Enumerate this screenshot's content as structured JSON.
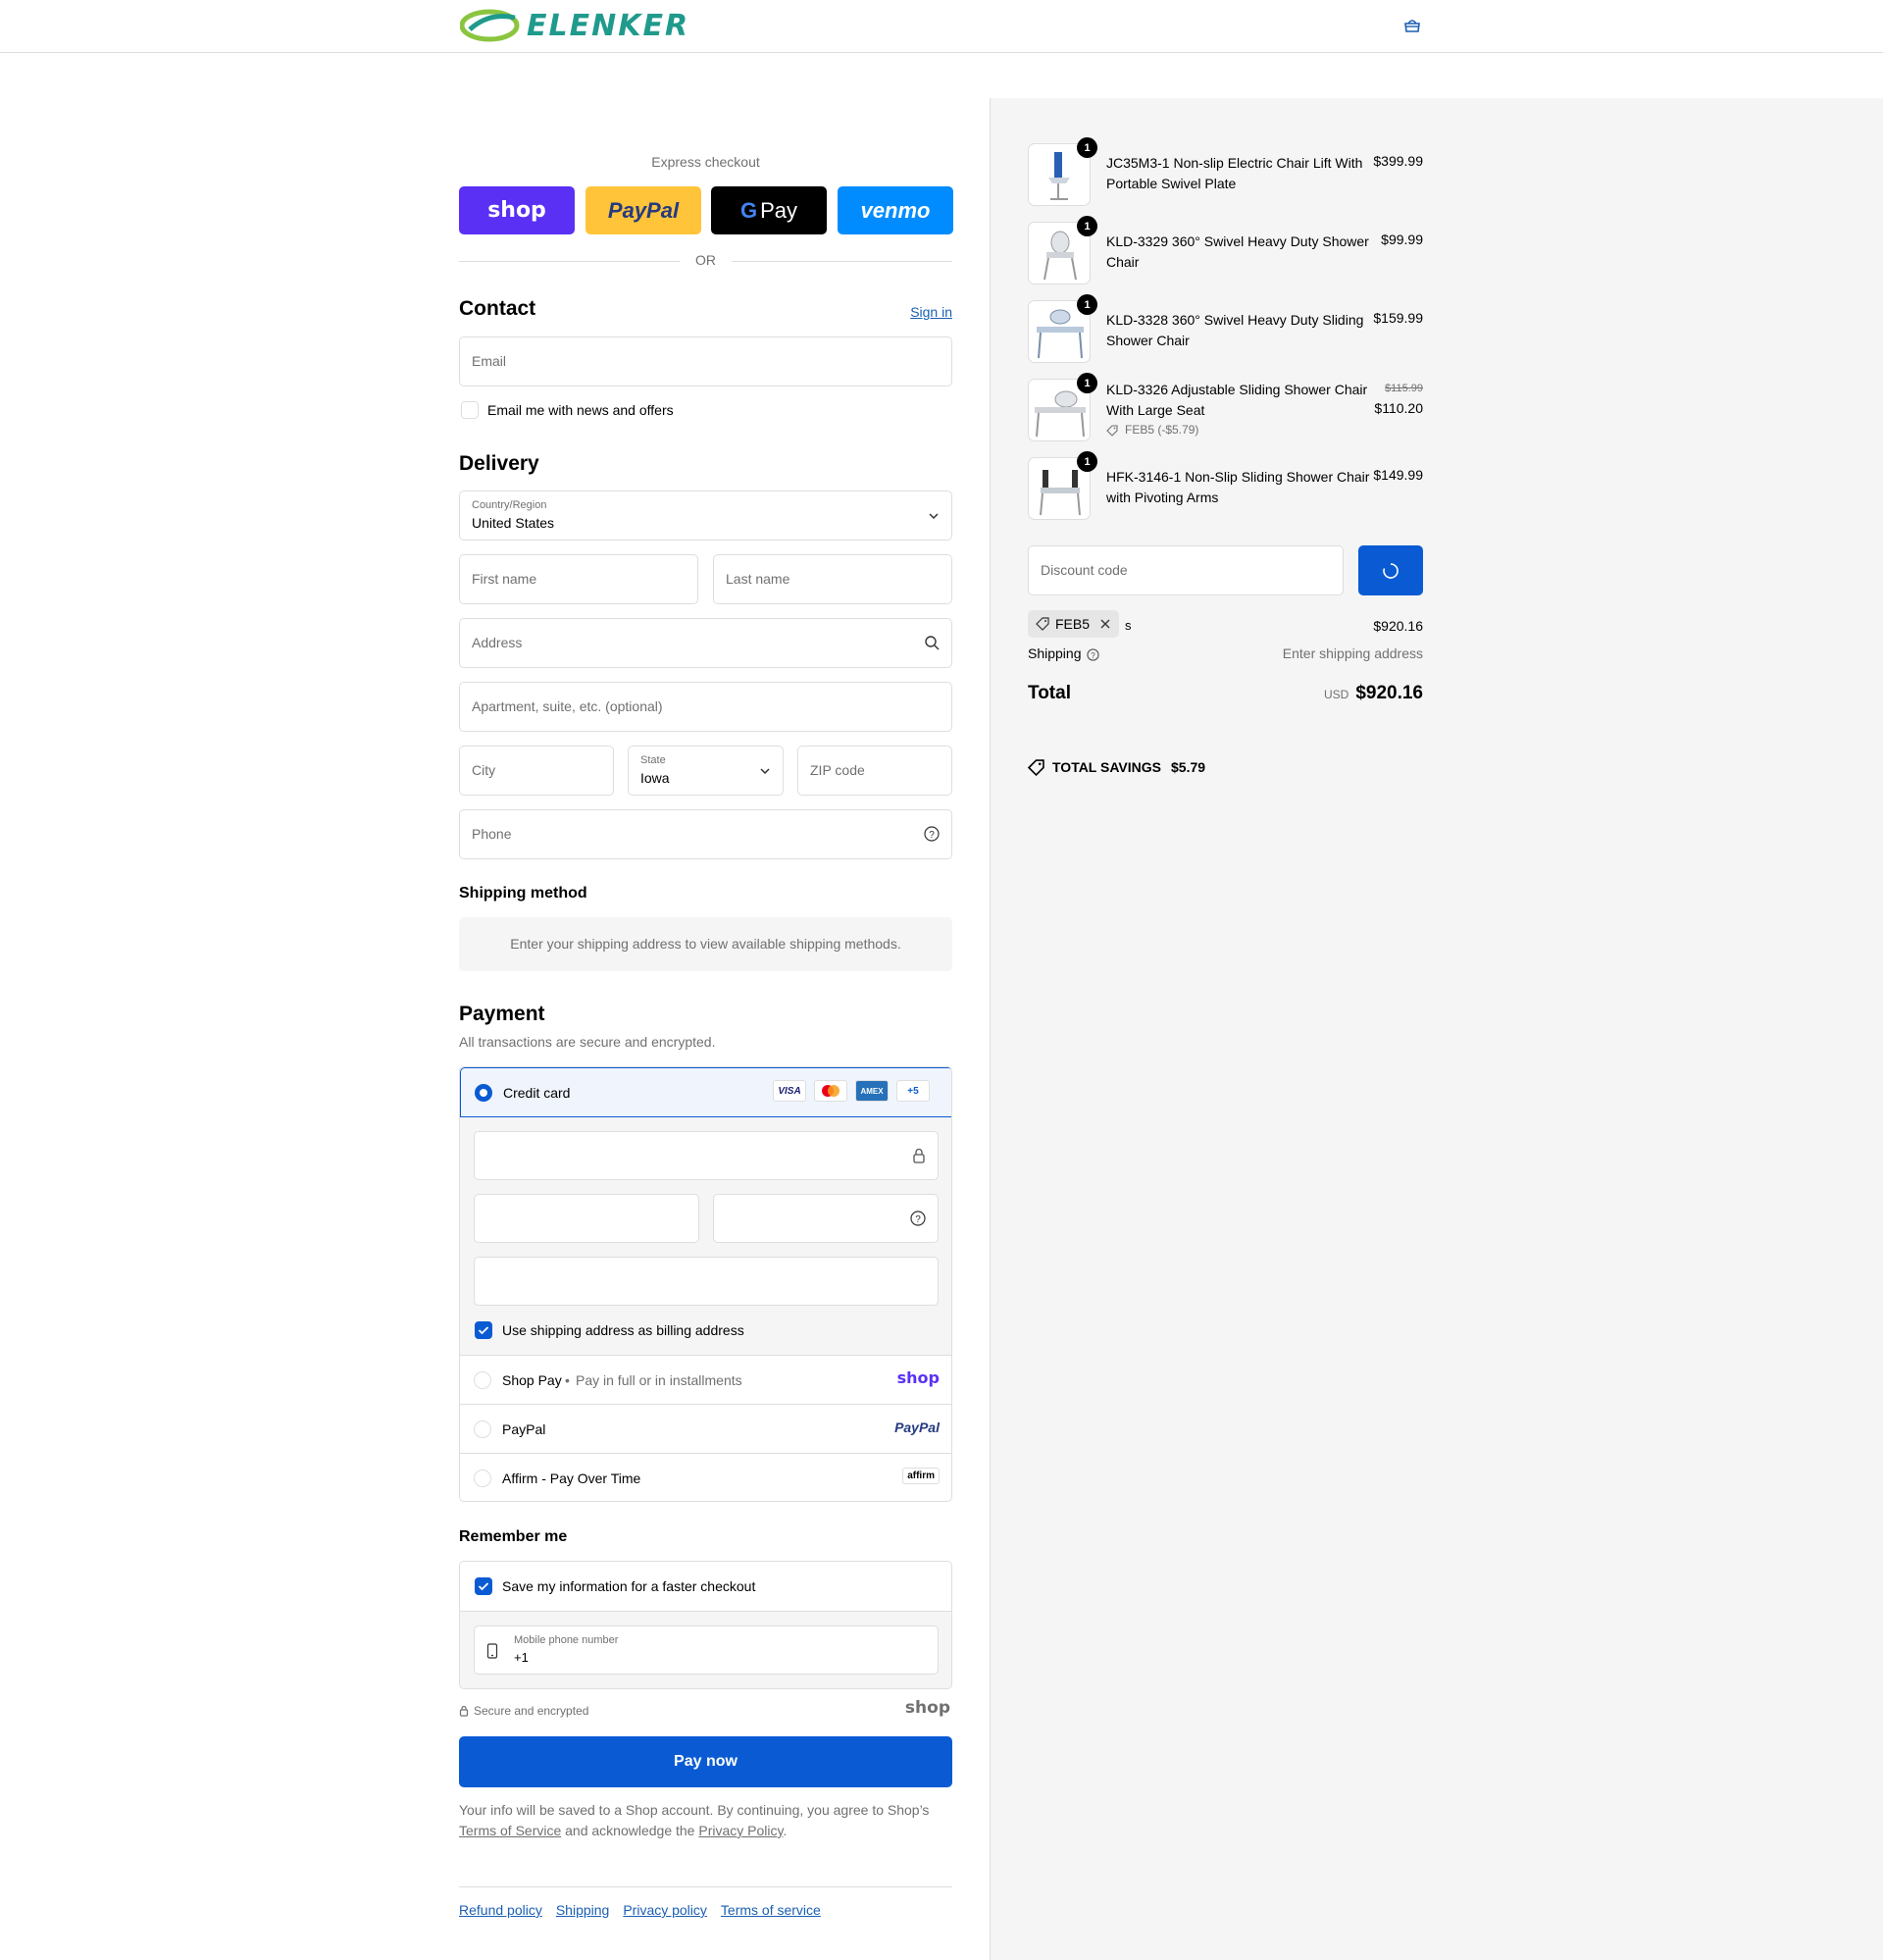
{
  "header": {
    "brand": "ELENKER"
  },
  "express": {
    "label": "Express checkout",
    "shop": "shop",
    "paypal": "PayPal",
    "gpay": "Pay",
    "venmo": "venmo",
    "or": "OR"
  },
  "contact": {
    "title": "Contact",
    "sign_in": "Sign in",
    "email_placeholder": "Email",
    "news_label": "Email me with news and offers"
  },
  "delivery": {
    "title": "Delivery",
    "country_label": "Country/Region",
    "country_value": "United States",
    "first_name": "First name",
    "last_name": "Last name",
    "address": "Address",
    "apartment": "Apartment, suite, etc. (optional)",
    "city": "City",
    "state_label": "State",
    "state_value": "Iowa",
    "zip": "ZIP code",
    "phone": "Phone"
  },
  "shipping_method": {
    "title": "Shipping method",
    "message": "Enter your shipping address to view available shipping methods."
  },
  "payment": {
    "title": "Payment",
    "subtitle": "All transactions are secure and encrypted.",
    "credit_card": "Credit card",
    "card_more": "+5",
    "card_logos": [
      "VISA",
      "",
      "AMEX"
    ],
    "billing_label": "Use shipping address as billing address",
    "shop_pay": "Shop Pay",
    "shop_pay_desc": "Pay in full or in installments",
    "shop_pay_logo": "shop",
    "paypal": "PayPal",
    "paypal_logo": "PayPal",
    "affirm": "Affirm - Pay Over Time",
    "affirm_logo": "affirm"
  },
  "remember": {
    "title": "Remember me",
    "save_label": "Save my information for a faster checkout",
    "mobile_label": "Mobile phone number",
    "mobile_value": "+1",
    "secure": "Secure and encrypted",
    "shop_logo": "shop"
  },
  "pay_now": "Pay now",
  "legal": {
    "prefix": "Your info will be saved to a Shop account. By continuing, you agree to Shop’s",
    "tos": "Terms of Service",
    "middle": "and acknowledge the",
    "privacy": "Privacy Policy",
    "suffix": "."
  },
  "footer_links": [
    "Refund policy",
    "Shipping",
    "Privacy policy",
    "Terms of service"
  ],
  "summary": {
    "items": [
      {
        "qty": "1",
        "name": "JC35M3-1 Non-slip Electric Chair Lift With Portable Swivel Plate",
        "price": "$399.99"
      },
      {
        "qty": "1",
        "name": "KLD-3329 360° Swivel Heavy Duty Shower Chair",
        "price": "$99.99"
      },
      {
        "qty": "1",
        "name": "KLD-3328 360° Swivel Heavy Duty Sliding Shower Chair",
        "price": "$159.99"
      },
      {
        "qty": "1",
        "name": "KLD-3326 Adjustable Sliding Shower Chair With Large Seat",
        "old_price": "$115.99",
        "price": "$110.20",
        "discount": "FEB5 (-$5.79)"
      },
      {
        "qty": "1",
        "name": "HFK-3146-1 Non-Slip Sliding Shower Chair with Pivoting Arms",
        "price": "$149.99"
      }
    ],
    "discount_placeholder": "Discount code",
    "applied_code": "FEB5",
    "subtotal_suffix": "s",
    "subtotal": "$920.16",
    "shipping_label": "Shipping",
    "shipping_value": "Enter shipping address",
    "total_label": "Total",
    "currency": "USD",
    "total": "$920.16",
    "savings_label": "TOTAL SAVINGS",
    "savings_value": "$5.79"
  },
  "colors": {
    "accent": "#0a5bd3",
    "shop": "#5a31f4",
    "paypal": "#ffc439",
    "venmo": "#008cff",
    "brand": "#1f9a8c"
  }
}
